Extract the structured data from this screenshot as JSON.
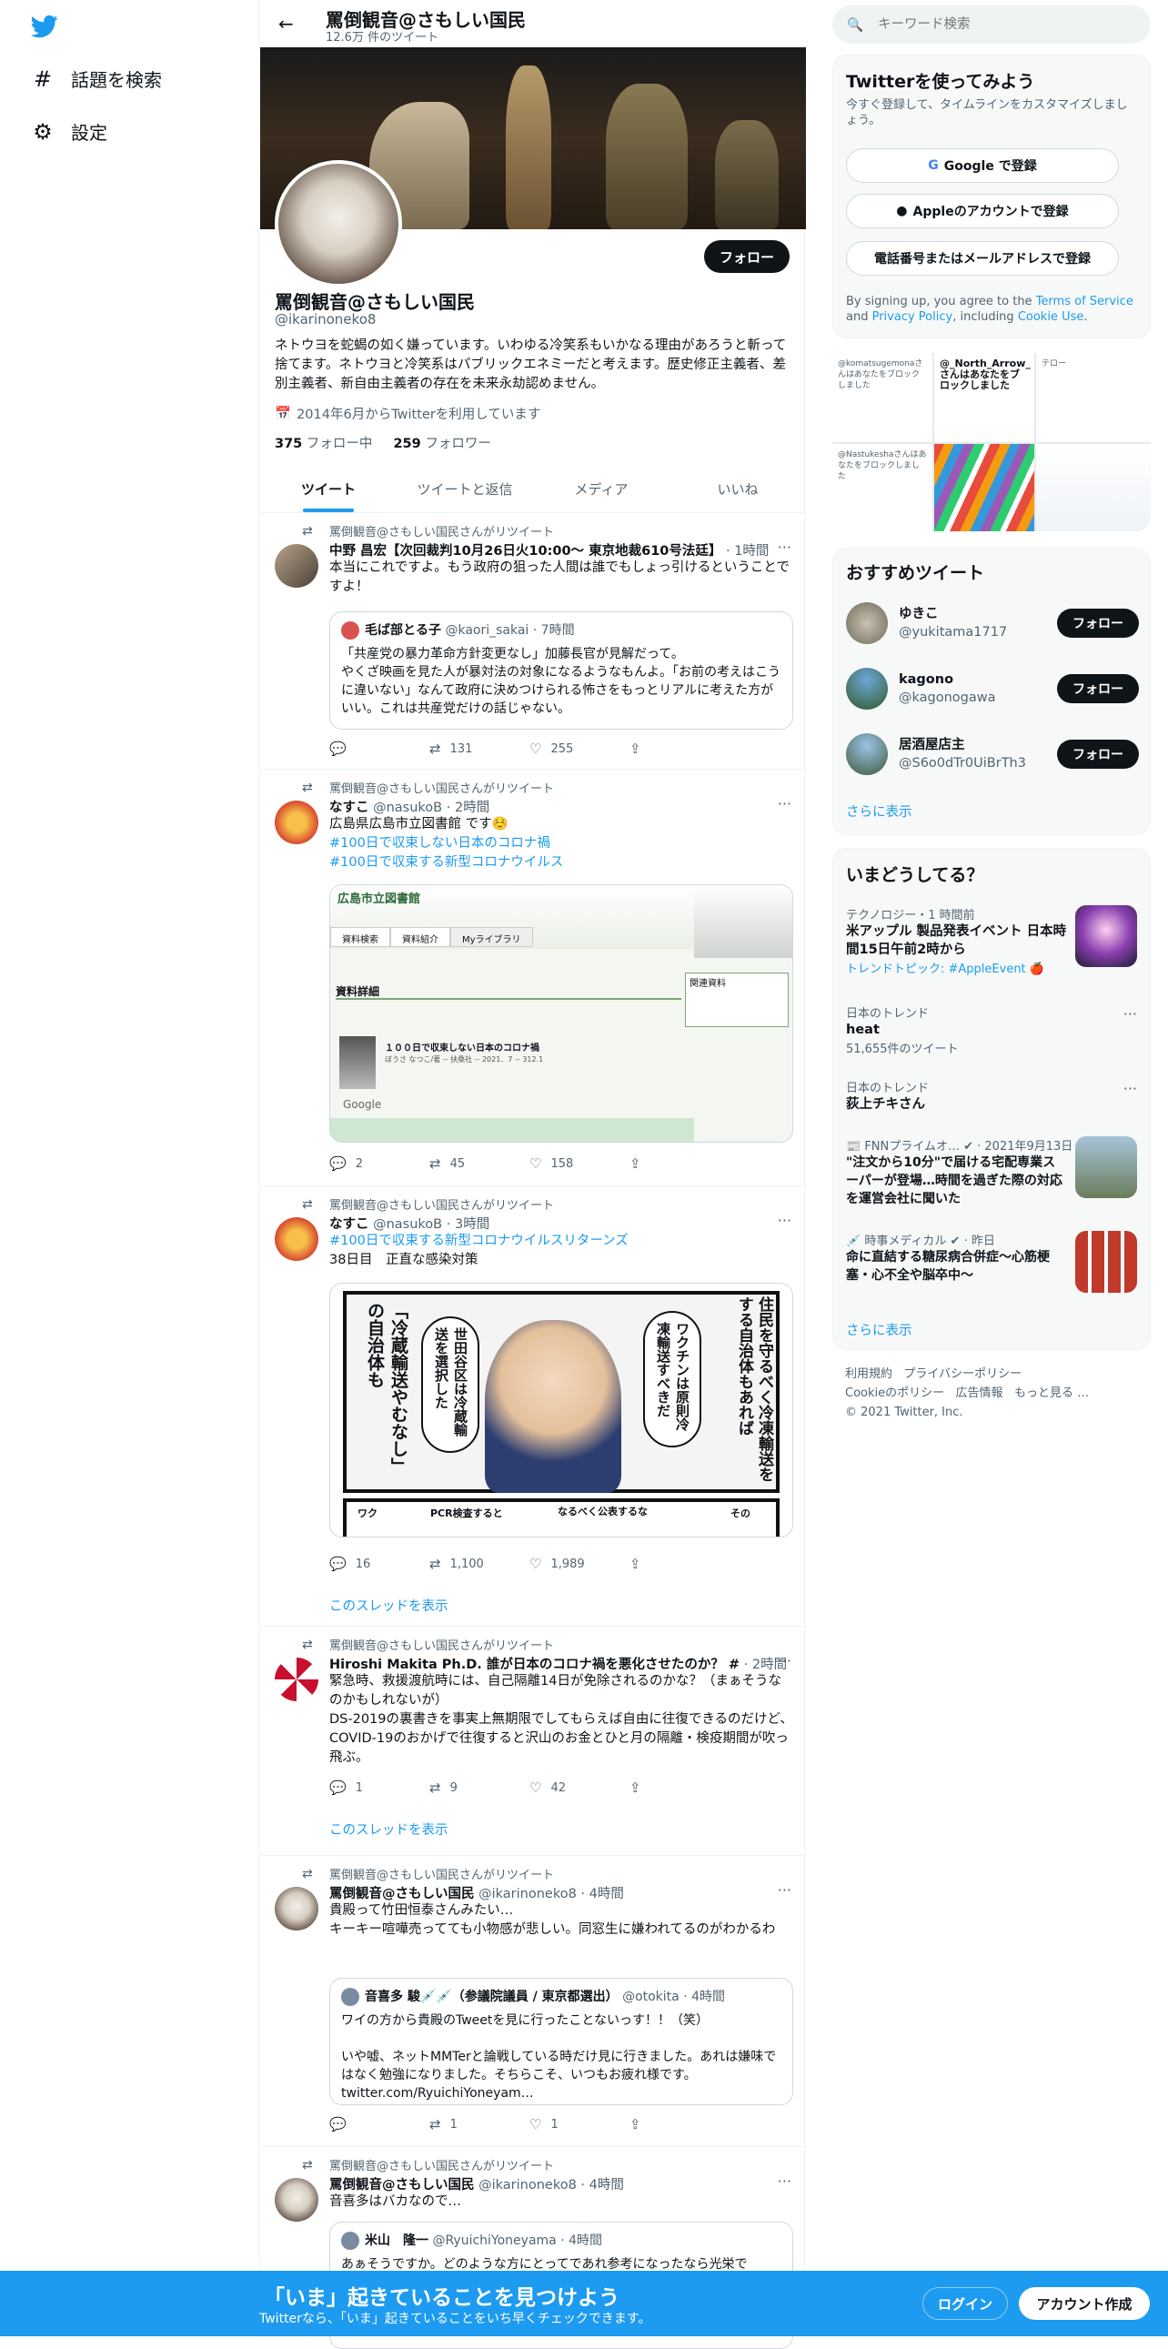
{
  "nav": {
    "logo": "twitter-bird",
    "items": [
      {
        "label": "話題を検索",
        "icon": "hash-icon"
      },
      {
        "label": "設定",
        "icon": "gear-icon"
      }
    ]
  },
  "header": {
    "name": "罵倒観音@さもしい国民",
    "tweet_count": "12.6万 件のツイート"
  },
  "profile": {
    "name": "罵倒観音@さもしい国民",
    "handle": "@ikarinoneko8",
    "follow_label": "フォロー",
    "bio": "ネトウヨを蛇蝎の如く嫌っています。いわゆる冷笑系もいかなる理由があろうと斬って捨てます。ネトウヨと冷笑系はパブリックエネミーだと考えます。歴史修正主義者、差別主義者、新自由主義者の存在を未来永劫認めません。",
    "joined": "2014年6月からTwitterを利用しています",
    "following_count": "375",
    "following_label": "フォロー中",
    "followers_count": "259",
    "followers_label": "フォロワー"
  },
  "tabs": [
    "ツイート",
    "ツイートと返信",
    "メディア",
    "いいね"
  ],
  "tweets": [
    {
      "retweeted_by": "罵倒観音@さもしい国民さんがリツイート",
      "name": "中野 昌宏【次回裁判10月26日火10:00〜 東京地裁610号法廷】",
      "handle": "",
      "time": "· 1時間",
      "text": "本当にこれですよ。もう政府の狙った人間は誰でもしょっ引けるということですよ！",
      "quote": {
        "name": "毛ば部とる子",
        "handle": "@kaori_sakai",
        "time": "· 7時間",
        "text": "「共産党の暴力革命方針変更なし」加藤長官が見解だって。\nやくざ映画を見た人が暴対法の対象になるようなもんよ。「お前の考えはこうに違いない」なんて政府に決めつけられる怖さをもっとリアルに考えた方がいい。これは共産党だけの話じゃない。"
      },
      "replies": "",
      "retweets": "131",
      "likes": "255"
    },
    {
      "retweeted_by": "罵倒観音@さもしい国民さんがリツイート",
      "name": "なすこ",
      "handle": "@nasukoB",
      "time": "· 2時間",
      "text": "広島県広島市立図書館 です☺️",
      "hashtags": [
        "#100日で収束しない日本のコロナ禍",
        "#100日で収束する新型コロナウイルス"
      ],
      "library": {
        "title": "広島市立図書館",
        "section": "資料詳細",
        "book_title": "１００日で収束しない日本のコロナ禍",
        "author_line": "ぼうさ なつこ/著 -- 扶桑社 -- 2021．7 -- 312.1",
        "menu": [
          "資料検索",
          "資料紹介",
          "Myライブラリ"
        ],
        "panel_title": "関連資料",
        "google": "Google"
      },
      "replies": "2",
      "retweets": "45",
      "likes": "158"
    },
    {
      "retweeted_by": "罵倒観音@さもしい国民さんがリツイート",
      "name": "なすこ",
      "handle": "@nasukoB",
      "time": "· 3時間",
      "hashtag": "#100日で収束する新型コロナウイルスリターンズ",
      "text": "38日目　正直な感染対策",
      "comic": {
        "right": "住民を守るべく冷凍輸送をする自治体もあれば",
        "bubble1": "ワクチンは原則冷凍輸送すべきだ",
        "bubble2": "世田谷区は冷蔵輸送を選択した",
        "left": "「冷蔵輸送やむなし」の自治体も",
        "bottom1": "なるべく公表するな",
        "bottom2": "PCR検査すると",
        "bottom3": "その",
        "bottom4": "ワク"
      },
      "replies": "16",
      "retweets": "1,100",
      "likes": "1,989",
      "show_thread": "このスレッドを表示"
    },
    {
      "retweeted_by": "罵倒観音@さもしい国民さんがリツイート",
      "name": "Hiroshi Makita Ph.D. 誰が日本のコロナ禍を悪化させたのか？ #",
      "handle": "",
      "time": "· 2時間",
      "text": "緊急時、救援渡航時には、自己隔離14日が免除されるのかな？（まぁそうなのかもしれないが）\nDS-2019の裏書きを事実上無期限でしてもらえば自由に往復できるのだけど、COVID-19のおかげで往復すると沢山のお金とひと月の隔離・検疫期間が吹っ飛ぶ。",
      "replies": "1",
      "retweets": "9",
      "likes": "42",
      "show_thread": "このスレッドを表示"
    },
    {
      "retweeted_by": "罵倒観音@さもしい国民さんがリツイート",
      "name": "罵倒観音@さもしい国民",
      "handle": "@ikarinoneko8",
      "time": "· 4時間",
      "text": "貴殿って竹田恒泰さんみたい…\nキーキー喧嘩売ってても小物感が悲しい。同窓生に嫌われてるのがわかるわ",
      "quote": {
        "name": "音喜多 駿💉💉（参議院議員 / 東京都選出）",
        "handle": "@otokita",
        "time": "· 4時間",
        "text": "ワイの方から貴殿のTweetを見に行ったことないっす！！（笑）\n\nいや嘘、ネットMMTerと論戦している時だけ見に行きました。あれは嫌味ではなく勉強になりました。そちらこそ、いつもお疲れ様です。\ntwitter.com/RyuichiYoneyam…"
      },
      "replies": "",
      "retweets": "1",
      "likes": "1"
    },
    {
      "retweeted_by": "罵倒観音@さもしい国民さんがリツイート",
      "name": "罵倒観音@さもしい国民",
      "handle": "@ikarinoneko8",
      "time": "· 4時間",
      "text": "音喜多はバカなので…",
      "quote": {
        "name": "米山　隆一",
        "handle": "@RyuichiYoneyama",
        "time": "· 4時間",
        "text": "あぁそうですか。どのような方にとってであれ参考になったなら光栄で"
      }
    }
  ],
  "right": {
    "search_placeholder": "キーワード検索",
    "signup": {
      "title": "Twitterを使ってみよう",
      "subtitle": "今すぐ登録して、タイムラインをカスタマイズしましょう。",
      "google": "Google で登録",
      "apple": "Appleのアカウントで登録",
      "phone": "電話番号またはメールアドレスで登録",
      "terms_pre": "By signing up, you agree to the ",
      "terms_link": "Terms of Service",
      "terms_mid": " and ",
      "privacy_link": "Privacy Policy",
      "terms_mid2": ", including ",
      "cookie_link": "Cookie Use",
      "terms_end": "."
    },
    "media_cells": [
      "@komatsugemonaさんはあなたをブロックしました",
      "@_North_Arrow_さんはあなたをブロックしました",
      "テロー",
      "@Nastukeshaさんはあなたをブロックしました",
      "",
      ""
    ],
    "recommend": {
      "title": "おすすめツイート",
      "users": [
        {
          "name": "ゆきこ",
          "handle": "@yukitama1717"
        },
        {
          "name": "kagono",
          "handle": "@kagonogawa"
        },
        {
          "name": "居酒屋店主",
          "handle": "@S6o0dTr0UiBrTh3"
        }
      ],
      "follow_label": "フォロー",
      "more": "さらに表示"
    },
    "trends": {
      "title": "いまどうしてる？",
      "items": [
        {
          "category": "テクノロジー・1 時間前",
          "title": "米アップル 製品発表イベント 日本時間15日午前2時から",
          "sub": "トレンドトピック: #AppleEvent 🍎"
        },
        {
          "category": "日本のトレンド",
          "title": "heat",
          "sub": "51,655件のツイート"
        },
        {
          "category": "日本のトレンド",
          "title": "荻上チキさん",
          "sub": ""
        },
        {
          "category": "📰 FNNプライムオ… ✔ · 2021年9月13日",
          "title": "\"注文から10分\"で届ける宅配専業スーパーが登場…時間を過ぎた際の対応を運営会社に聞いた",
          "sub": ""
        },
        {
          "category": "💉 時事メディカル ✔ · 昨日",
          "title": "命に直結する糖尿病合併症～心筋梗塞・心不全や脳卒中～",
          "sub": ""
        }
      ],
      "more": "さらに表示"
    },
    "footer": {
      "links": [
        "利用規約",
        "プライバシーポリシー",
        "Cookieのポリシー",
        "広告情報",
        "もっと見る …"
      ],
      "copyright": "© 2021 Twitter, Inc."
    }
  },
  "bottom": {
    "title": "「いま」起きていることを見つけよう",
    "subtitle": "Twitterなら、「いま」起きていることをいち早くチェックできます。",
    "login": "ログイン",
    "signup": "アカウント作成"
  },
  "colors": {
    "accent": "#1d9bf0",
    "text": "#0f1419",
    "muted": "#536471"
  }
}
